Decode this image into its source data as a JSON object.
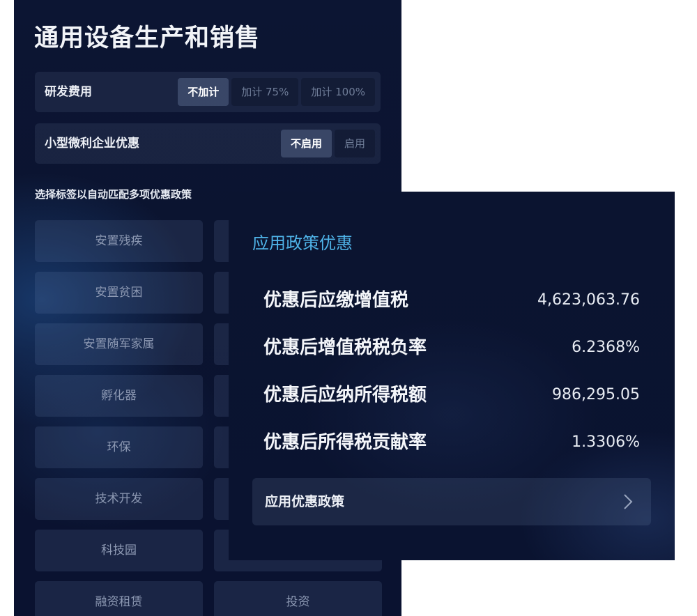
{
  "left_panel": {
    "title": "通用设备生产和销售",
    "rd_expense": {
      "label": "研发费用",
      "options": [
        "不加计",
        "加计 75%",
        "加计 100%"
      ],
      "selected": "不加计"
    },
    "small_business": {
      "label": "小型微利企业优惠",
      "options": [
        "不启用",
        "启用"
      ],
      "selected": "不启用"
    },
    "hint": "选择标签以自动匹配多项优惠政策",
    "tags": [
      "安置残疾",
      "",
      "安置贫困",
      "",
      "安置随军家属",
      "",
      "孵化器",
      "",
      "环保",
      "",
      "技术开发",
      "",
      "科技园",
      "",
      "融资租赁",
      "投资"
    ]
  },
  "right_panel": {
    "title": "应用政策优惠",
    "metrics": [
      {
        "label": "优惠后应缴增值税",
        "value": "4,623,063.76"
      },
      {
        "label": "优惠后增值税税负率",
        "value": "6.2368%"
      },
      {
        "label": "优惠后应纳所得税额",
        "value": "986,295.05"
      },
      {
        "label": "优惠后所得税贡献率",
        "value": "1.3306%"
      }
    ],
    "apply_button": {
      "label": "应用优惠政策",
      "icon": "chevron-right-icon"
    }
  },
  "colors": {
    "panel_background": "#0b1430",
    "accent_title": "#4fb3e8",
    "tag_text": "#8d99b3"
  }
}
